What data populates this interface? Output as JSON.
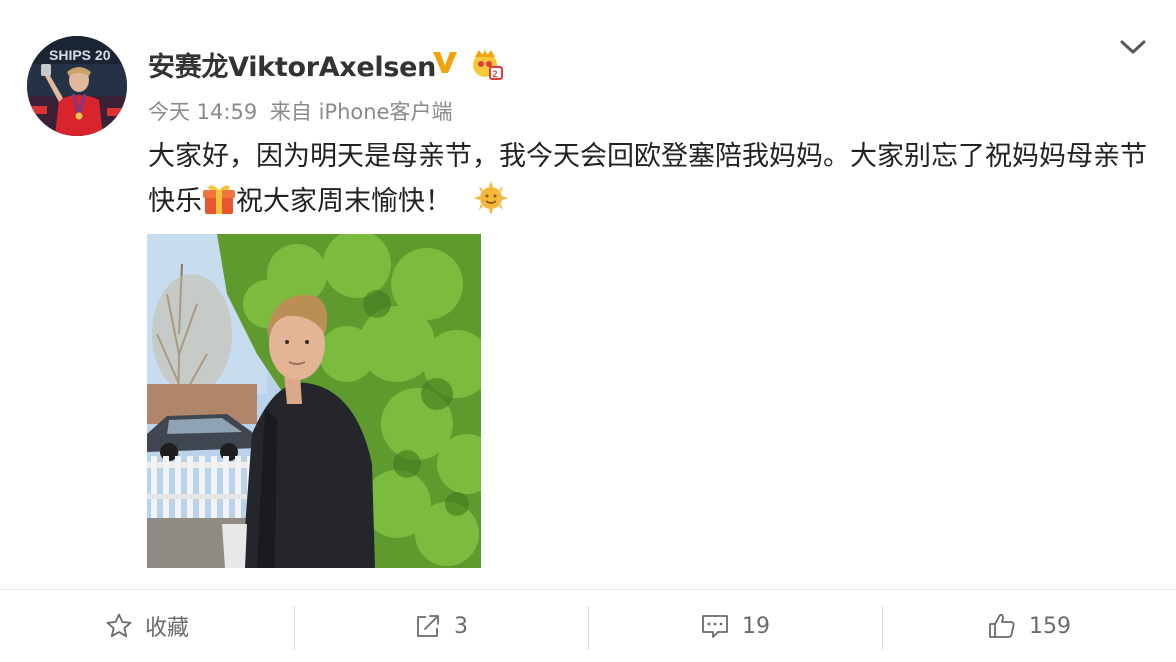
{
  "post": {
    "author": {
      "name": "安赛龙ViktorAxelsen",
      "avatar_icon": "avatar-photo",
      "verified_icon": "verified-v-icon",
      "vip_icon": "vip-crown-icon",
      "colors": {
        "verified": "#f2a20c",
        "vip": "#f2b322"
      }
    },
    "meta": {
      "time": "今天 14:59",
      "source": "来自 iPhone客户端"
    },
    "text_part1": "大家好，因为明天是母亲节，我今天会回欧登塞陪我妈妈。大家别忘了祝妈妈母亲节快乐",
    "gift_icon": "gift-emoji",
    "text_part2": "祝大家周末愉快！",
    "sun_icon": "sun-emoji",
    "photo_description_icon": "photo-thumbnail"
  },
  "actions": {
    "favorite": {
      "label": "收藏",
      "icon": "star-icon"
    },
    "repost": {
      "count": "3",
      "icon": "share-icon"
    },
    "comment": {
      "count": "19",
      "icon": "comment-icon"
    },
    "like": {
      "count": "159",
      "icon": "thumbs-up-icon"
    }
  },
  "menu_icon": "chevron-down-icon"
}
